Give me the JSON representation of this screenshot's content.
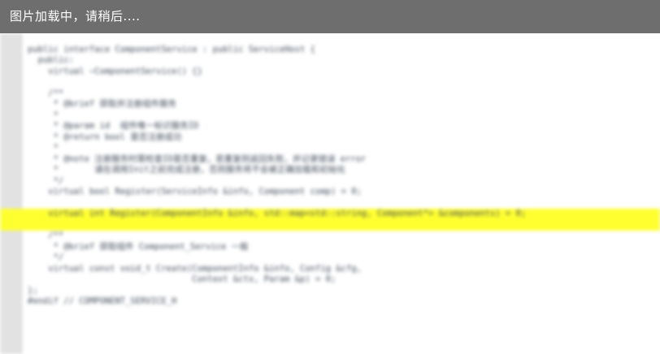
{
  "overlay": {
    "loading_text": "图片加载中，请稍后...."
  },
  "editor": {
    "highlight_color": "#ffff30",
    "lines": [
      {
        "n": "",
        "code": ""
      },
      {
        "n": "",
        "code": "public interface ComponentService : public ServiceHost {"
      },
      {
        "n": "",
        "code": "  public:"
      },
      {
        "n": "",
        "code": "    virtual ~ComponentService() {}"
      },
      {
        "n": "",
        "code": ""
      },
      {
        "n": "",
        "code": "    /**"
      },
      {
        "n": "",
        "code": "     * @brief 获取并注册组件服务"
      },
      {
        "n": "",
        "code": "     *"
      },
      {
        "n": "",
        "code": "     * @param id  组件唯一标识服务ID"
      },
      {
        "n": "",
        "code": "     * @return bool 是否注册成功"
      },
      {
        "n": "",
        "code": "     *"
      },
      {
        "n": "",
        "code": "     * @note 注册服务时需检查ID是否重复，若重复则返回失败，并记录错误 error"
      },
      {
        "n": "",
        "code": "     *       请在调用Init之前完成注册，否则服务将不会被正确加载和初始化"
      },
      {
        "n": "",
        "code": "     */"
      },
      {
        "n": "",
        "code": "    virtual bool Register(ServiceInfo &info, Component comp) = 0;"
      },
      {
        "n": "",
        "code": ""
      },
      {
        "n": "",
        "code": "    virtual int Register(ComponentInfo &info, std::map<std::string, Component*> &components) = 0;"
      },
      {
        "n": "",
        "code": ""
      },
      {
        "n": "",
        "code": "    /**"
      },
      {
        "n": "",
        "code": "     * @brief 获取组件 Component_Service 一般"
      },
      {
        "n": "",
        "code": "     */"
      },
      {
        "n": "",
        "code": "    virtual const void_t Create(ComponentInfo &info, Config &cfg,"
      },
      {
        "n": "",
        "code": "                                Context &ctx, Param &p) = 0;"
      },
      {
        "n": "",
        "code": "};"
      },
      {
        "n": "",
        "code": "#endif // COMPONENT_SERVICE_H"
      },
      {
        "n": "",
        "code": ""
      },
      {
        "n": "",
        "code": ""
      },
      {
        "n": "",
        "code": ""
      },
      {
        "n": "",
        "code": ""
      }
    ],
    "highlighted_lines": [
      16,
      17
    ]
  }
}
